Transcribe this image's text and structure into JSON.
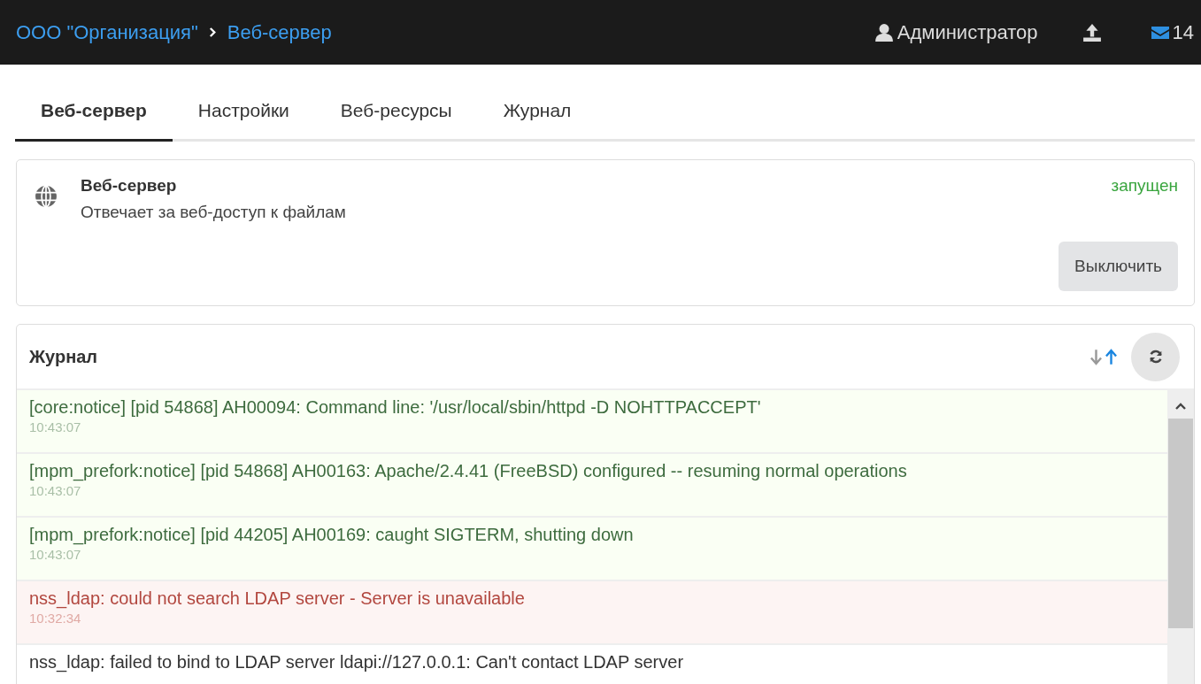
{
  "header": {
    "breadcrumb": [
      "ООО \"Организация\"",
      "Веб-сервер"
    ],
    "user": "Администратор",
    "messages_count": "14"
  },
  "tabs": [
    {
      "label": "Веб-сервер",
      "selected": true
    },
    {
      "label": "Настройки",
      "selected": false
    },
    {
      "label": "Веб-ресурсы",
      "selected": false
    },
    {
      "label": "Журнал",
      "selected": false
    }
  ],
  "service": {
    "title": "Веб-сервер",
    "description": "Отвечает за веб-доступ к файлам",
    "status": "запущен",
    "button": "Выключить"
  },
  "log": {
    "title": "Журнал",
    "sort_buttons": [
      {
        "kind": "down",
        "selected": false
      },
      {
        "kind": "up",
        "selected": true
      }
    ],
    "entries": [
      {
        "kind": "notice",
        "message": "[core:notice] [pid 54868] AH00094: Command line: '/usr/local/sbin/httpd -D NOHTTPACCEPT'",
        "time": "10:43:07"
      },
      {
        "kind": "notice",
        "message": "[mpm_prefork:notice] [pid 54868] AH00163: Apache/2.4.41 (FreeBSD) configured -- resuming normal operations",
        "time": "10:43:07"
      },
      {
        "kind": "notice",
        "message": "[mpm_prefork:notice] [pid 44205] AH00169: caught SIGTERM, shutting down",
        "time": "10:43:07"
      },
      {
        "kind": "error",
        "message": "nss_ldap: could not search LDAP server - Server is unavailable",
        "time": "10:32:34"
      },
      {
        "kind": "info",
        "message": "nss_ldap: failed to bind to LDAP server ldapi://127.0.0.1: Can't contact LDAP server"
      }
    ]
  }
}
